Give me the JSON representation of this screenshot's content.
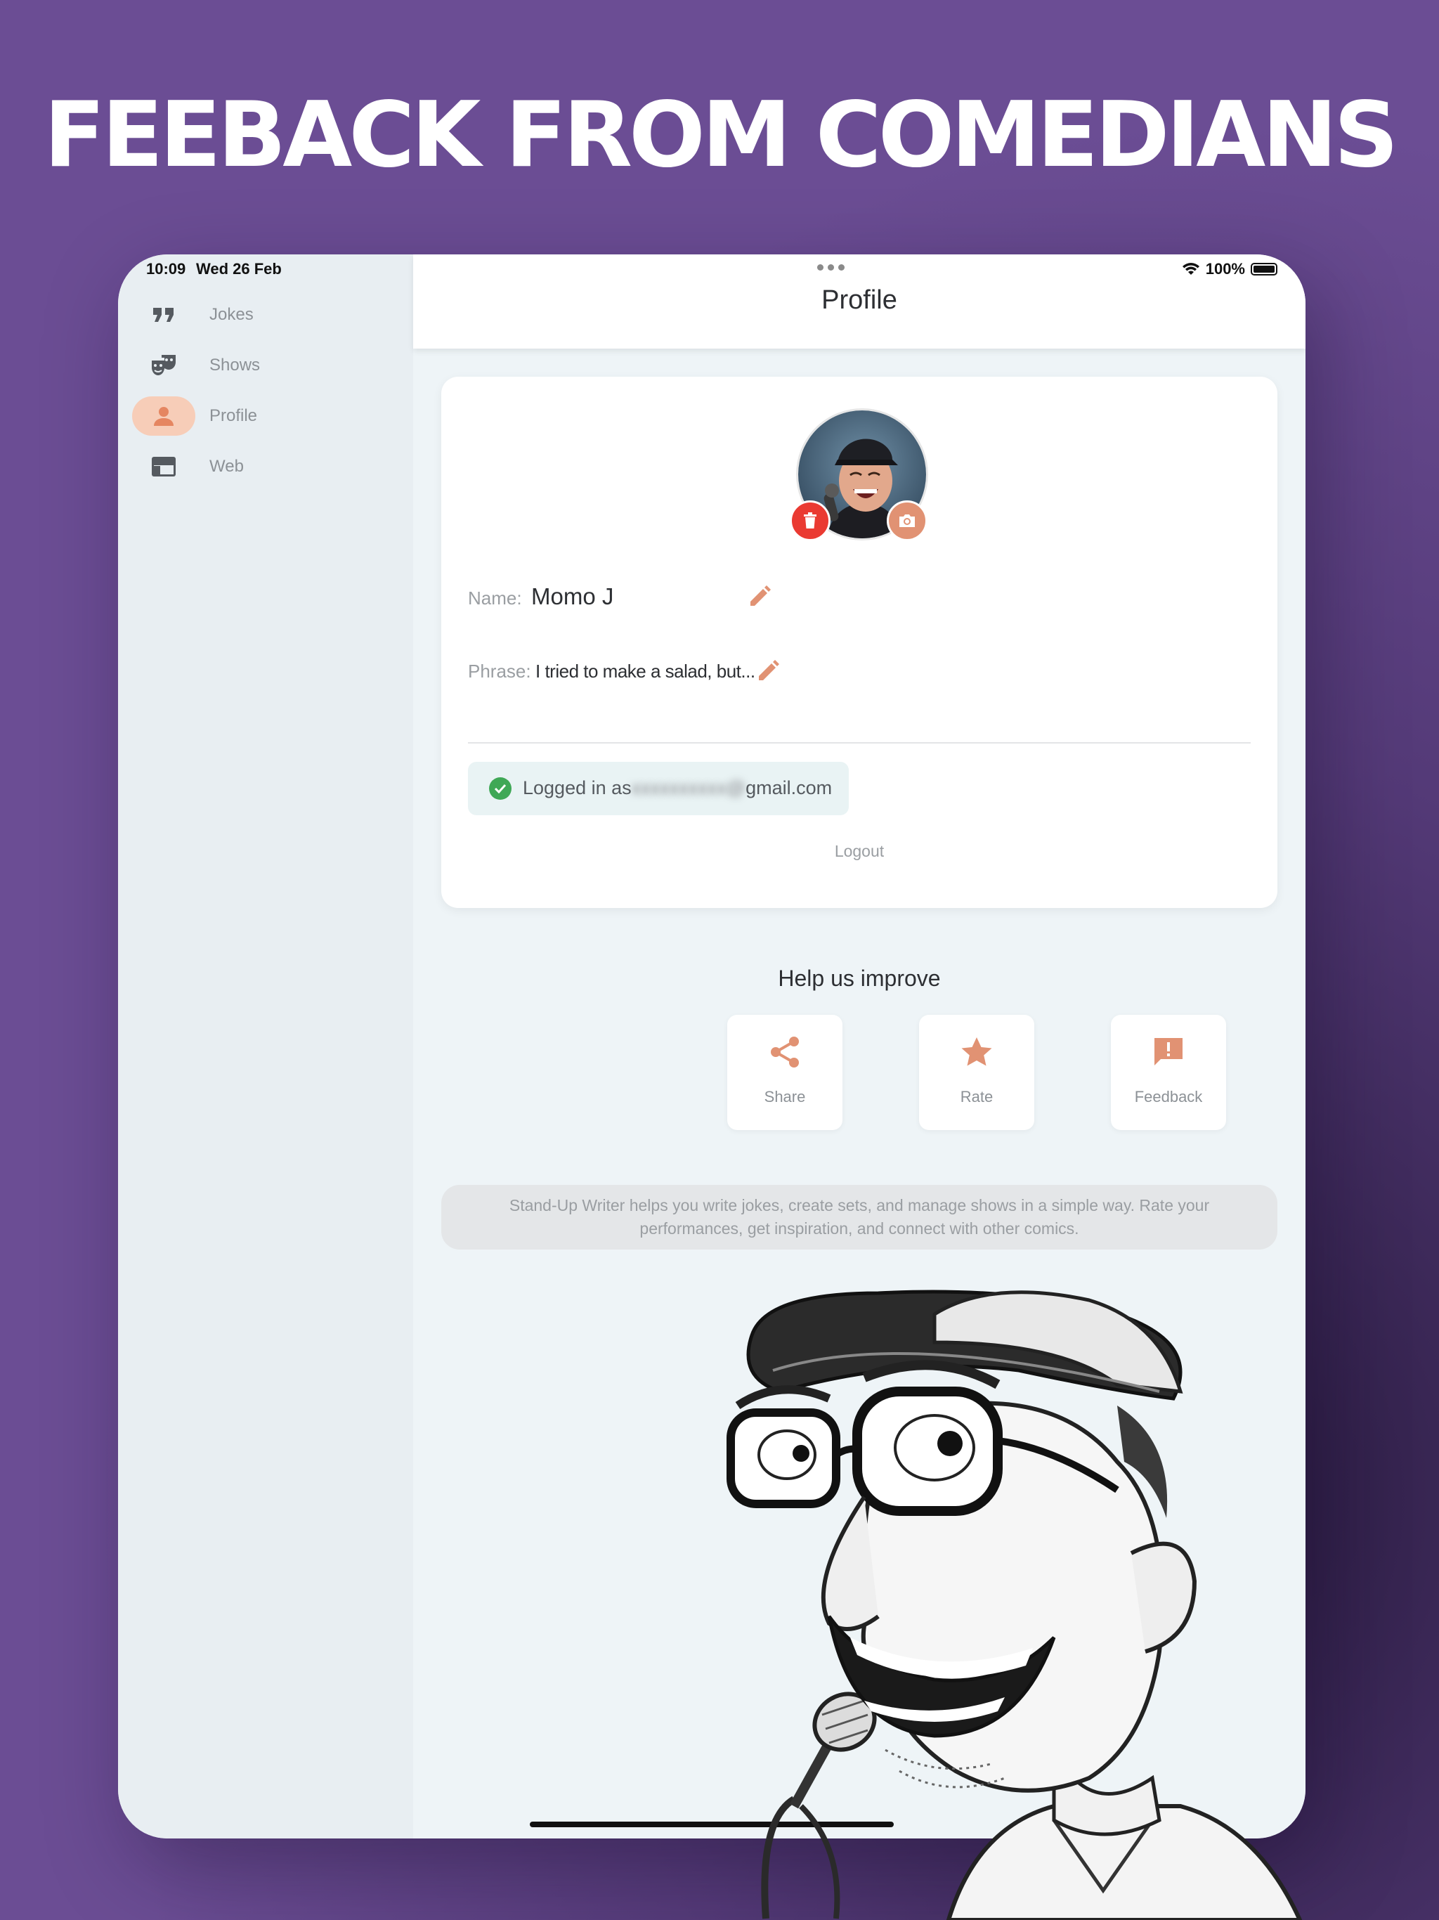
{
  "headline": "FEEBACK FROM COMEDIANS",
  "status": {
    "time": "10:09",
    "date": "Wed 26 Feb",
    "battery": "100%"
  },
  "sidebar": {
    "items": [
      {
        "label": "Jokes",
        "icon": "quote-icon",
        "active": false
      },
      {
        "label": "Shows",
        "icon": "theater-masks-icon",
        "active": false
      },
      {
        "label": "Profile",
        "icon": "person-icon",
        "active": true
      },
      {
        "label": "Web",
        "icon": "web-window-icon",
        "active": false
      }
    ]
  },
  "appbar": {
    "title": "Profile"
  },
  "profile": {
    "name_label": "Name:",
    "name_value": "Momo J",
    "phrase_label": "Phrase:",
    "phrase_value": "I tried to make a salad, but...",
    "login_prefix": "Logged in as",
    "login_suffix": "gmail.com",
    "logout_label": "Logout"
  },
  "help": {
    "title": "Help us improve",
    "actions": [
      {
        "label": "Share",
        "icon": "share-icon"
      },
      {
        "label": "Rate",
        "icon": "star-icon"
      },
      {
        "label": "Feedback",
        "icon": "feedback-icon"
      }
    ]
  },
  "info_text": "Stand-Up Writer helps you write jokes, create sets, and manage shows in a simple way. Rate your performances, get inspiration, and connect with other comics.",
  "colors": {
    "background": "#6b4d94",
    "accent": "#e19273",
    "delete": "#ea3a32",
    "success": "#3fa856"
  }
}
